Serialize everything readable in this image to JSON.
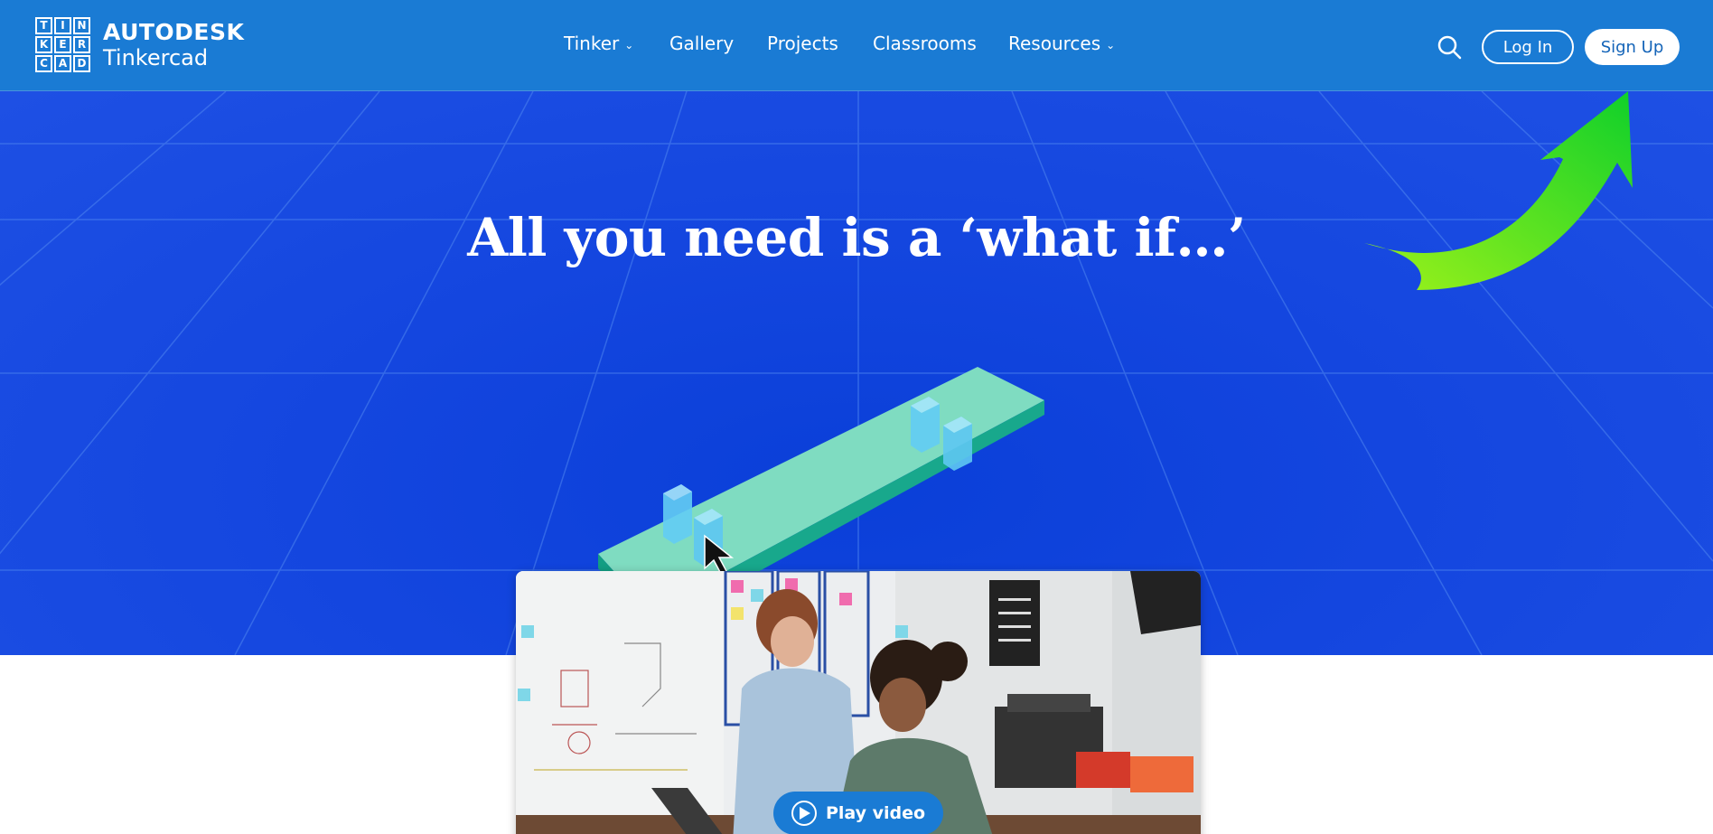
{
  "header": {
    "logo": {
      "letters": [
        "T",
        "I",
        "N",
        "K",
        "E",
        "R",
        "C",
        "A",
        "D"
      ],
      "brand": "AUTODESK",
      "product": "Tinkercad"
    },
    "nav": [
      {
        "label": "Tinker",
        "dropdown": true
      },
      {
        "label": "Gallery",
        "dropdown": false
      },
      {
        "label": "Projects",
        "dropdown": false
      },
      {
        "label": "Classrooms",
        "dropdown": false
      },
      {
        "label": "Resources",
        "dropdown": true
      }
    ],
    "search_icon": "search-icon",
    "login_label": "Log In",
    "signup_label": "Sign Up"
  },
  "hero": {
    "title": "All you need is a ‘what if…’",
    "annotation_arrow_color": "#22d32a"
  },
  "video": {
    "play_label": "Play video",
    "play_icon": "play-circle-icon"
  },
  "colors": {
    "nav_bg": "#1a7bd4",
    "hero_bg": "#1446df",
    "button_text": "#1464b8",
    "plate_top": "#7fdcc1",
    "plate_side": "#18a88c",
    "block": "#5ec8f2"
  }
}
